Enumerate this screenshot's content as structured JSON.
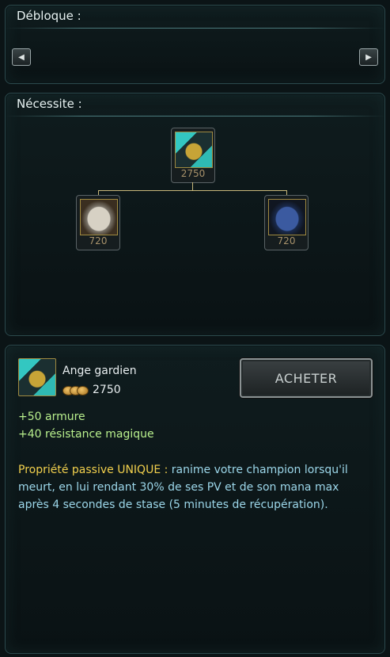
{
  "unlock": {
    "title": "Débloque :",
    "left_arrow": "◀",
    "right_arrow": "▶"
  },
  "requires": {
    "title": "Nécessite :",
    "root": {
      "icon": "guardian-angel-icon",
      "cost": "2750"
    },
    "components": [
      {
        "icon": "cloth-armor-icon",
        "cost": "720"
      },
      {
        "icon": "chain-vest-icon",
        "cost": "720"
      }
    ]
  },
  "detail": {
    "icon": "guardian-angel-icon",
    "name": "Ange gardien",
    "gold": "2750",
    "buy_label": "ACHETER",
    "stats": [
      "+50 armure",
      "+40 résistance magique"
    ],
    "passive_label": "Propriété passive UNIQUE :",
    "passive_text": " ranime votre champion lorsqu'il meurt, en lui rendant 30% de ses PV et de son mana max après 4 secondes de stase (5 minutes de récupération)."
  },
  "colors": {
    "stat_green": "#b9f08d",
    "unique_yellow": "#f2d04d",
    "passive_blue": "#9cd7ea",
    "gold_cost": "#a7916a"
  }
}
